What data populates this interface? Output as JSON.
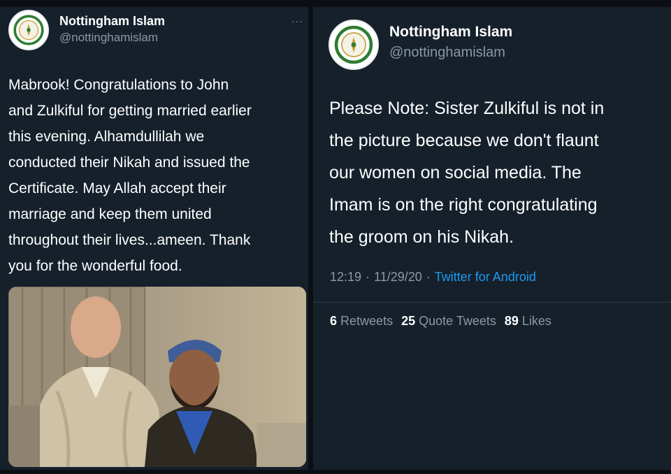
{
  "left_tweet": {
    "author": {
      "display_name": "Nottingham Islam",
      "handle": "@nottinghamislam",
      "avatar_icon": "organization-logo-icon"
    },
    "more_label": "···",
    "text_lines": [
      "Mabrook! Congratulations to John",
      "and Zulkiful for getting married earlier",
      "this evening. Alhamdullilah we",
      "conducted their Nikah and issued the",
      "Certificate. May Allah accept their",
      "marriage and keep them united",
      "throughout their lives...ameen. Thank",
      "you for the wonderful food."
    ],
    "media_icon": "photo-two-men-icon"
  },
  "right_tweet": {
    "author": {
      "display_name": "Nottingham Islam",
      "handle": "@nottinghamislam",
      "avatar_icon": "organization-logo-icon"
    },
    "text_lines": [
      "Please Note: Sister Zulkiful is not in",
      "the picture because we don't flaunt",
      "our women on social media. The",
      "Imam is on the right congratulating",
      "the groom on his Nikah."
    ],
    "time": "12:19",
    "date": "11/29/20",
    "separator": "·",
    "source": "Twitter for Android",
    "stats": {
      "retweets_count": "6",
      "retweets_label": "Retweets",
      "quote_tweets_count": "25",
      "quote_tweets_label": "Quote Tweets",
      "likes_count": "89",
      "likes_label": "Likes"
    }
  },
  "colors": {
    "background": "#15202b",
    "text_primary": "#ffffff",
    "text_secondary": "#8b98a5",
    "link": "#1d9bf0"
  }
}
